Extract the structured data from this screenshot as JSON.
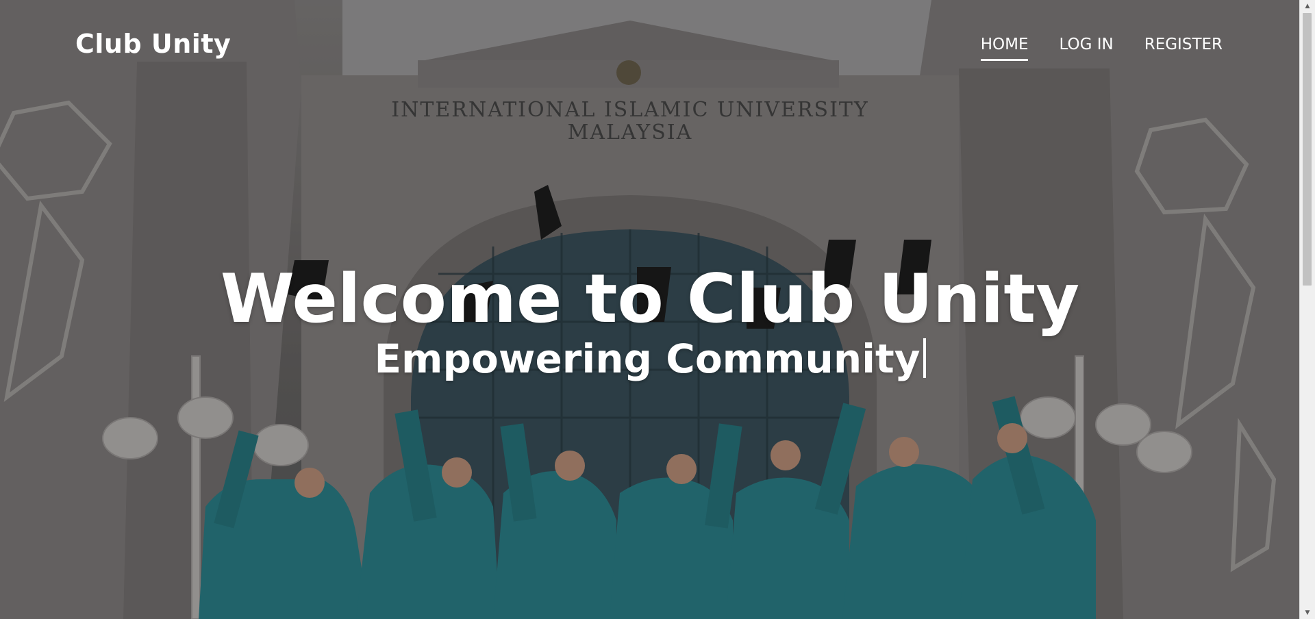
{
  "brand": {
    "name": "Club Unity"
  },
  "nav": {
    "items": [
      {
        "label": "HOME",
        "active": true
      },
      {
        "label": "LOG IN",
        "active": false
      },
      {
        "label": "REGISTER",
        "active": false
      }
    ]
  },
  "hero": {
    "title": "Welcome to Club Unity",
    "subtitle": "Empowering Community",
    "building_sign_line1": "INTERNATIONAL ISLAMIC UNIVERSITY",
    "building_sign_line2": "MALAYSIA"
  },
  "colors": {
    "text": "#ffffff",
    "overlay": "rgba(0,0,0,0.28)",
    "gown": "#2e8a94"
  }
}
